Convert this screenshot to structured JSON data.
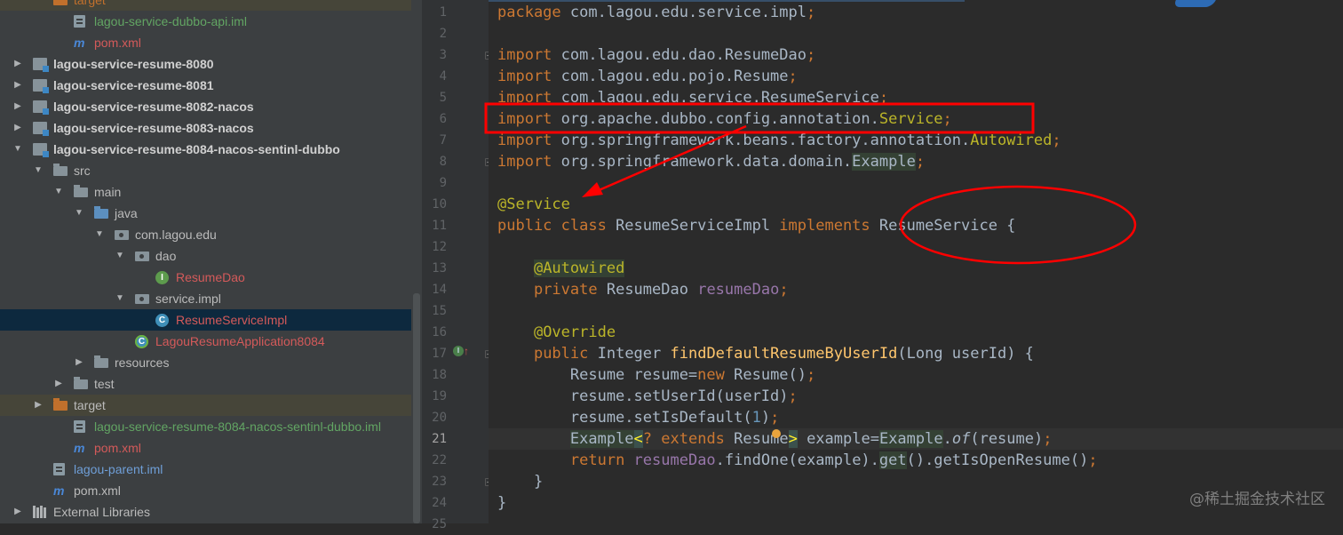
{
  "project_tree": {
    "items": [
      {
        "label": "target",
        "indent": 1,
        "icon": "folder-orange",
        "arrow": "none",
        "style": "normal",
        "highlight": true
      },
      {
        "label": "lagou-service-dubbo-api.iml",
        "indent": 2,
        "icon": "iml-file",
        "arrow": "none",
        "style": "green"
      },
      {
        "label": "pom.xml",
        "indent": 2,
        "icon": "maven",
        "arrow": "none",
        "style": "red"
      },
      {
        "label": "lagou-service-resume-8080",
        "indent": 0,
        "icon": "module",
        "arrow": "collapsed",
        "style": "bold"
      },
      {
        "label": "lagou-service-resume-8081",
        "indent": 0,
        "icon": "module",
        "arrow": "collapsed",
        "style": "bold"
      },
      {
        "label": "lagou-service-resume-8082-nacos",
        "indent": 0,
        "icon": "module",
        "arrow": "collapsed",
        "style": "bold"
      },
      {
        "label": "lagou-service-resume-8083-nacos",
        "indent": 0,
        "icon": "module",
        "arrow": "collapsed",
        "style": "bold"
      },
      {
        "label": "lagou-service-resume-8084-nacos-sentinl-dubbo",
        "indent": 0,
        "icon": "module",
        "arrow": "expanded",
        "style": "bold"
      },
      {
        "label": "src",
        "indent": 1,
        "icon": "folder",
        "arrow": "expanded",
        "style": "normal"
      },
      {
        "label": "main",
        "indent": 2,
        "icon": "folder",
        "arrow": "expanded",
        "style": "normal"
      },
      {
        "label": "java",
        "indent": 3,
        "icon": "folder-blue",
        "arrow": "expanded",
        "style": "normal"
      },
      {
        "label": "com.lagou.edu",
        "indent": 4,
        "icon": "package",
        "arrow": "expanded",
        "style": "normal"
      },
      {
        "label": "dao",
        "indent": 5,
        "icon": "package",
        "arrow": "expanded",
        "style": "normal"
      },
      {
        "label": "ResumeDao",
        "indent": 6,
        "icon": "interface",
        "arrow": "none",
        "style": "red"
      },
      {
        "label": "service.impl",
        "indent": 5,
        "icon": "package",
        "arrow": "expanded",
        "style": "normal"
      },
      {
        "label": "ResumeServiceImpl",
        "indent": 6,
        "icon": "class",
        "arrow": "none",
        "style": "red",
        "selected": true
      },
      {
        "label": "LagouResumeApplication8084",
        "indent": 5,
        "icon": "spring-class",
        "arrow": "none",
        "style": "red"
      },
      {
        "label": "resources",
        "indent": 3,
        "icon": "folder",
        "arrow": "collapsed",
        "style": "normal"
      },
      {
        "label": "test",
        "indent": 2,
        "icon": "folder",
        "arrow": "collapsed",
        "style": "normal"
      },
      {
        "label": "target",
        "indent": 1,
        "icon": "folder-orange",
        "arrow": "collapsed",
        "style": "normal",
        "highlight": true
      },
      {
        "label": "lagou-service-resume-8084-nacos-sentinl-dubbo.iml",
        "indent": 2,
        "icon": "iml-file",
        "arrow": "none",
        "style": "green"
      },
      {
        "label": "pom.xml",
        "indent": 2,
        "icon": "maven",
        "arrow": "none",
        "style": "red"
      },
      {
        "label": "lagou-parent.iml",
        "indent": 1,
        "icon": "iml-file",
        "arrow": "none",
        "style": "blue"
      },
      {
        "label": "pom.xml",
        "indent": 1,
        "icon": "maven",
        "arrow": "none",
        "style": "normal"
      },
      {
        "label": "External Libraries",
        "indent": 0,
        "icon": "libraries",
        "arrow": "collapsed",
        "style": "normal"
      }
    ]
  },
  "editor": {
    "current_line": 21,
    "lines": [
      {
        "n": "1",
        "tokens": [
          [
            "kw",
            "package "
          ],
          [
            "",
            "com.lagou.edu.service.impl"
          ],
          [
            "kw",
            ";"
          ]
        ]
      },
      {
        "n": "2",
        "tokens": []
      },
      {
        "n": "3",
        "tokens": [
          [
            "kw",
            "import "
          ],
          [
            "",
            "com.lagou.edu.dao.ResumeDao"
          ],
          [
            "kw",
            ";"
          ]
        ]
      },
      {
        "n": "4",
        "tokens": [
          [
            "kw",
            "import "
          ],
          [
            "",
            "com.lagou.edu.pojo.Resume"
          ],
          [
            "kw",
            ";"
          ]
        ]
      },
      {
        "n": "5",
        "tokens": [
          [
            "kw",
            "import "
          ],
          [
            "",
            "com.lagou.edu.service.ResumeService"
          ],
          [
            "kw",
            ";"
          ]
        ]
      },
      {
        "n": "6",
        "tokens": [
          [
            "kw",
            "import "
          ],
          [
            "",
            "org.apache.dubbo.config.annotation."
          ],
          [
            "an",
            "Service"
          ],
          [
            "kw",
            ";"
          ]
        ]
      },
      {
        "n": "7",
        "tokens": [
          [
            "kw",
            "import "
          ],
          [
            "",
            "org.springframework.beans.factory.annotation."
          ],
          [
            "an",
            "Autowired"
          ],
          [
            "kw",
            ";"
          ]
        ]
      },
      {
        "n": "8",
        "tokens": [
          [
            "kw",
            "import "
          ],
          [
            "",
            "org.springframework.data.domain."
          ],
          [
            "hlw",
            "Example"
          ],
          [
            "kw",
            ";"
          ]
        ]
      },
      {
        "n": "9",
        "tokens": []
      },
      {
        "n": "10",
        "tokens": [
          [
            "an",
            "@Service"
          ]
        ]
      },
      {
        "n": "11",
        "tokens": [
          [
            "kw",
            "public class "
          ],
          [
            "",
            "ResumeServiceImpl "
          ],
          [
            "kw",
            "implements "
          ],
          [
            "",
            "ResumeService {"
          ]
        ]
      },
      {
        "n": "12",
        "tokens": []
      },
      {
        "n": "13",
        "tokens": [
          [
            "",
            "    "
          ],
          [
            "an hlw",
            "@Autowired"
          ]
        ]
      },
      {
        "n": "14",
        "tokens": [
          [
            "",
            "    "
          ],
          [
            "kw",
            "private "
          ],
          [
            "",
            "ResumeDao "
          ],
          [
            "fld",
            "resumeDao"
          ],
          [
            "kw",
            ";"
          ]
        ]
      },
      {
        "n": "15",
        "tokens": []
      },
      {
        "n": "16",
        "tokens": [
          [
            "",
            "    "
          ],
          [
            "an",
            "@Override"
          ]
        ]
      },
      {
        "n": "17",
        "tokens": [
          [
            "",
            "    "
          ],
          [
            "kw",
            "public "
          ],
          [
            "",
            "Integer "
          ],
          [
            "fn",
            "findDefaultResumeByUserId"
          ],
          [
            "",
            "(Long userId) {"
          ]
        ]
      },
      {
        "n": "18",
        "tokens": [
          [
            "",
            "        Resume resume="
          ],
          [
            "kw",
            "new "
          ],
          [
            "",
            "Resume()"
          ],
          [
            "kw",
            ";"
          ]
        ]
      },
      {
        "n": "19",
        "tokens": [
          [
            "",
            "        resume.setUserId(userId)"
          ],
          [
            "kw",
            ";"
          ]
        ]
      },
      {
        "n": "20",
        "tokens": [
          [
            "",
            "        resume.setIsDefault("
          ],
          [
            "num",
            "1"
          ],
          [
            "",
            ")"
          ],
          [
            "kw",
            ";"
          ]
        ]
      },
      {
        "n": "21",
        "tokens": [
          [
            "",
            "        "
          ],
          [
            "hlw",
            "Example"
          ],
          [
            "brk",
            "<"
          ],
          [
            "kw",
            "? extends "
          ],
          [
            "",
            "Resume"
          ],
          [
            "brk",
            ">"
          ],
          [
            "",
            " example="
          ],
          [
            "hlw",
            "Example"
          ],
          [
            "",
            ".",
            ""
          ],
          [
            "ital",
            "of"
          ],
          [
            "",
            "(resume)"
          ],
          [
            "kw",
            ";"
          ]
        ]
      },
      {
        "n": "22",
        "tokens": [
          [
            "",
            "        "
          ],
          [
            "kw",
            "return "
          ],
          [
            "fld",
            "resumeDao"
          ],
          [
            "",
            ".findOne(example)."
          ],
          [
            "hlw",
            "get"
          ],
          [
            "",
            "().getIsOpenResume()"
          ],
          [
            "kw",
            ";"
          ]
        ]
      },
      {
        "n": "23",
        "tokens": [
          [
            "",
            "    }"
          ]
        ]
      },
      {
        "n": "24",
        "tokens": [
          [
            "",
            "}"
          ]
        ]
      },
      {
        "n": "25",
        "tokens": []
      }
    ]
  },
  "watermark": "@稀土掘金技术社区",
  "colors": {
    "keyword": "#cc7832",
    "annotation": "#bbb529",
    "method": "#ffc66d",
    "field": "#9876aa",
    "number": "#6897bb",
    "annotation_mark": "#ff0000"
  }
}
